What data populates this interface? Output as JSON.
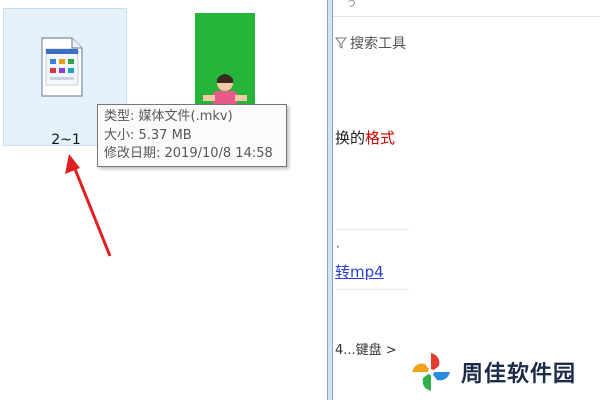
{
  "explorer": {
    "file": {
      "name": "2~1",
      "icon": "media-file-icon"
    },
    "thumbnail": {
      "icon": "video-thumbnail"
    }
  },
  "tooltip": {
    "type": "类型: 媒体文件(.mkv)",
    "size": "大小: 5.37 MB",
    "modified": "修改日期: 2019/10/8 14:58"
  },
  "browser": {
    "top_fragment": "ぅ",
    "search_tools": "搜索工具",
    "snippet_prefix": "换的",
    "snippet_highlight": "格式",
    "dot": "·",
    "link_text": "转mp4",
    "keyboard_text": "4...键盘 >",
    "brand_name": "周佳软件园"
  },
  "colors": {
    "highlight": "#cc0000",
    "link": "#2a3fd6",
    "arrow": "#e02020",
    "thumbnail_green": "#27b43a"
  }
}
